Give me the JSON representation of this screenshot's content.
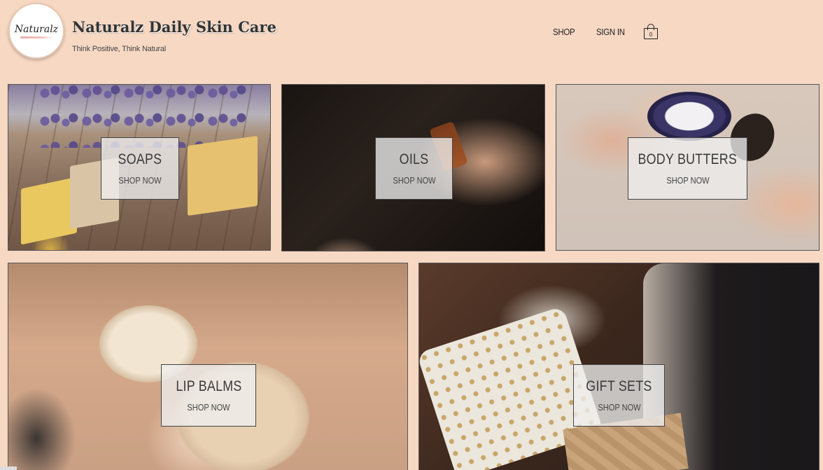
{
  "header": {
    "logo_text": "Naturalz",
    "site_title": "Naturalz Daily Skin Care",
    "tagline": "Think Positive, Think Natural"
  },
  "nav": {
    "shop": "Shop",
    "sign_in": "Sign In",
    "cart_count": "0"
  },
  "categories": [
    {
      "title": "Soaps",
      "cta": "Shop Now",
      "icon": "soaps-photo"
    },
    {
      "title": "Oils",
      "cta": "Shop Now",
      "icon": "oils-photo"
    },
    {
      "title": "Body Butters",
      "cta": "Shop Now",
      "icon": "body-butters-photo"
    },
    {
      "title": "Lip Balms",
      "cta": "Shop Now",
      "icon": "lip-balms-photo"
    },
    {
      "title": "Gift Sets",
      "cta": "Shop Now",
      "icon": "gift-sets-photo"
    }
  ],
  "colors": {
    "page_background": "#f7d8c3",
    "overlay_background": "#eeeeee",
    "text": "#333333"
  }
}
